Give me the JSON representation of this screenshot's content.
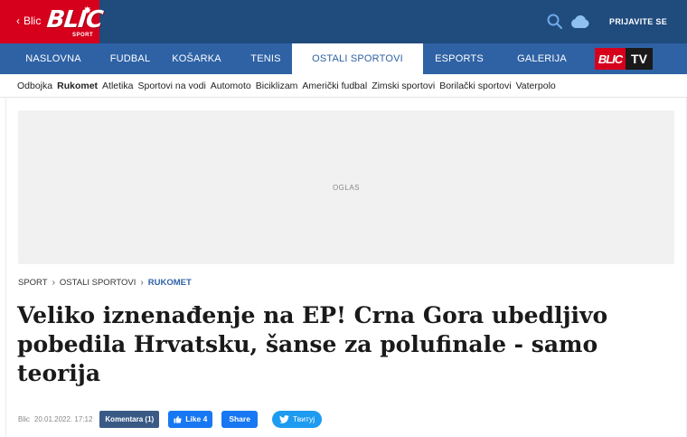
{
  "colors": {
    "brand_red": "#d6001c",
    "top_bar": "#1f4b7d",
    "nav_bar": "#2e62a5",
    "facebook": "#1877f2",
    "twitter": "#1d9bf0"
  },
  "header": {
    "back_label": "Blic",
    "logo_text": "BLIC",
    "logo_subtext": "SPORT",
    "login_label": "PRIJAVITE SE",
    "icons": [
      "search-icon",
      "weather-cloud-icon"
    ]
  },
  "nav": {
    "items": [
      {
        "label": "NASLOVNA",
        "active": false
      },
      {
        "label": "FUDBAL",
        "active": false
      },
      {
        "label": "KOŠARKA",
        "active": false
      },
      {
        "label": "TENIS",
        "active": false
      },
      {
        "label": "OSTALI SPORTOVI",
        "active": true
      },
      {
        "label": "ESPORTS",
        "active": false
      },
      {
        "label": "GALERIJA",
        "active": false
      }
    ],
    "tv_badge": {
      "brand": "BLIC",
      "label": "TV"
    }
  },
  "subnav": {
    "items": [
      {
        "label": "Odbojka",
        "active": false
      },
      {
        "label": "Rukomet",
        "active": true
      },
      {
        "label": "Atletika",
        "active": false
      },
      {
        "label": "Sportovi na vodi",
        "active": false
      },
      {
        "label": "Automoto",
        "active": false
      },
      {
        "label": "Biciklizam",
        "active": false
      },
      {
        "label": "Američki fudbal",
        "active": false
      },
      {
        "label": "Zimski sportovi",
        "active": false
      },
      {
        "label": "Borilački sportovi",
        "active": false
      },
      {
        "label": "Vaterpolo",
        "active": false
      }
    ]
  },
  "ad": {
    "label": "OGLAS"
  },
  "breadcrumb": {
    "items": [
      "SPORT",
      "OSTALI SPORTOVI",
      "RUKOMET"
    ]
  },
  "article": {
    "headline": "Veliko iznenađenje na EP! Crna Gora ubedljivo pobedila Hrvatsku, šanse za polufinale - samo teorija",
    "source": "Blic",
    "date": "20.01.2022. 17:12",
    "comments_label": "Komentara (1)",
    "like_label": "Like 4",
    "share_label": "Share",
    "tweet_label": "Твитуј"
  }
}
